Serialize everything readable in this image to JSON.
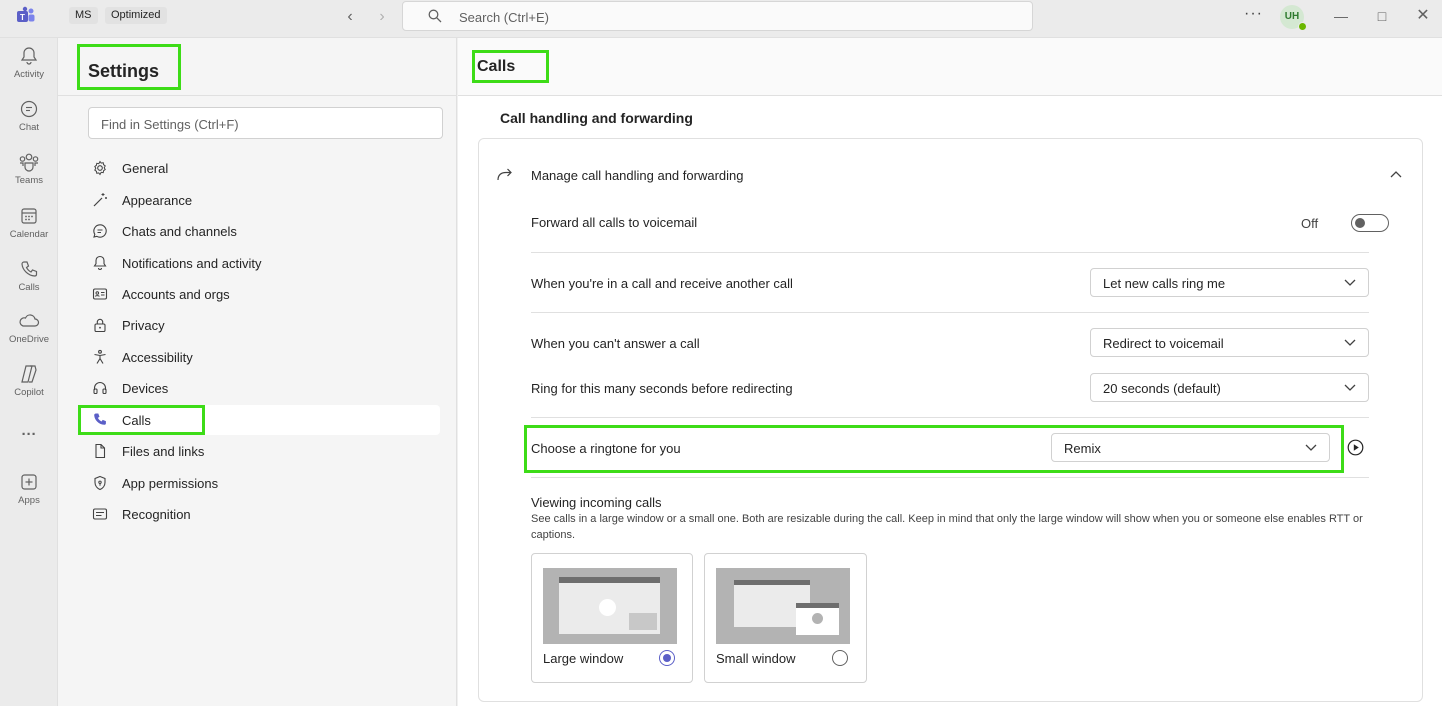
{
  "titlebar": {
    "org_chip": "MS",
    "mode_chip": "Optimized",
    "search_placeholder": "Search (Ctrl+E)",
    "more": "···",
    "avatar_initials": "UH"
  },
  "rail": [
    {
      "label": "Activity",
      "icon": "bell-icon"
    },
    {
      "label": "Chat",
      "icon": "chat-icon"
    },
    {
      "label": "Teams",
      "icon": "teams-icon"
    },
    {
      "label": "Calendar",
      "icon": "calendar-icon"
    },
    {
      "label": "Calls",
      "icon": "phone-icon"
    },
    {
      "label": "OneDrive",
      "icon": "cloud-icon"
    },
    {
      "label": "Copilot",
      "icon": "copilot-icon"
    },
    {
      "label": "···",
      "icon": "more-icon"
    },
    {
      "label": "Apps",
      "icon": "apps-icon"
    }
  ],
  "settings": {
    "title": "Settings",
    "find_placeholder": "Find in Settings (Ctrl+F)",
    "nav": [
      {
        "label": "General",
        "icon": "gear-icon"
      },
      {
        "label": "Appearance",
        "icon": "wand-icon"
      },
      {
        "label": "Chats and channels",
        "icon": "chat-icon"
      },
      {
        "label": "Notifications and activity",
        "icon": "bell-icon"
      },
      {
        "label": "Accounts and orgs",
        "icon": "id-card-icon"
      },
      {
        "label": "Privacy",
        "icon": "lock-icon"
      },
      {
        "label": "Accessibility",
        "icon": "accessibility-icon"
      },
      {
        "label": "Devices",
        "icon": "headset-icon"
      },
      {
        "label": "Calls",
        "icon": "phone-icon",
        "selected": true
      },
      {
        "label": "Files and links",
        "icon": "document-icon"
      },
      {
        "label": "App permissions",
        "icon": "shield-icon"
      },
      {
        "label": "Recognition",
        "icon": "recognition-icon"
      }
    ]
  },
  "main": {
    "title": "Calls",
    "section_title": "Call handling and forwarding",
    "manage_label": "Manage call handling and forwarding",
    "forward_label": "Forward all calls to voicemail",
    "forward_state": "Off",
    "another_call_label": "When you're in a call and receive another call",
    "another_call_value": "Let new calls ring me",
    "cant_answer_label": "When you can't answer a call",
    "cant_answer_value": "Redirect to voicemail",
    "ring_label": "Ring for this many seconds before redirecting",
    "ring_value": "20 seconds (default)",
    "ringtone_label": "Choose a ringtone for you",
    "ringtone_value": "Remix",
    "viewing_title": "Viewing incoming calls",
    "viewing_desc_1": "See calls in a large window or a small one. Both are resizable during the call. Keep in mind that only the large window will show when you or someone else enables RTT or",
    "viewing_desc_2": "captions.",
    "large_window": "Large window",
    "small_window": "Small window",
    "selected_window": "large"
  },
  "colors": {
    "highlight": "#3ddc17",
    "accent": "#5b5fc7"
  }
}
